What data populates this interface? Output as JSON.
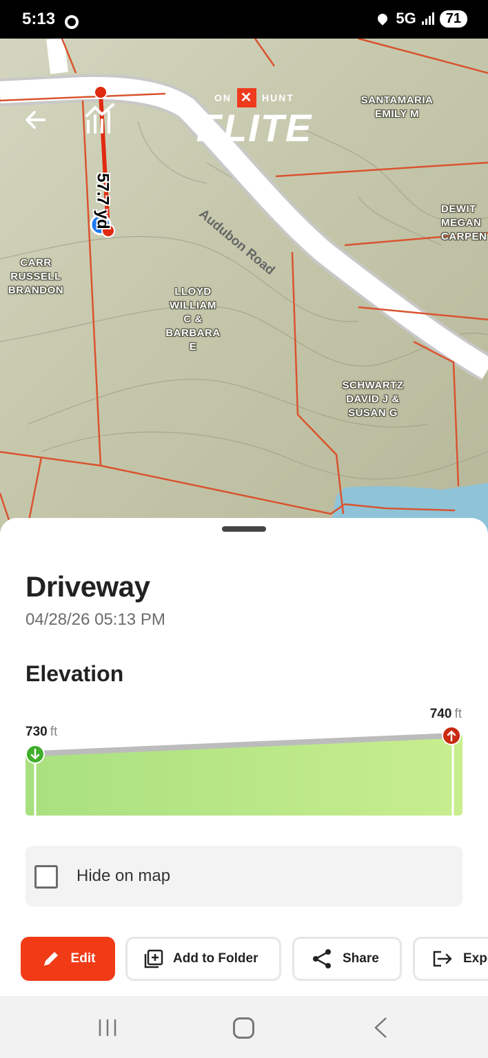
{
  "status_bar": {
    "time": "5:13",
    "network": "5G",
    "battery": "71"
  },
  "map": {
    "brand_top_left": "ON",
    "brand_x": "✕",
    "brand_top_right": "HUNT",
    "brand_main": "ELITE",
    "road_name": "Audubon Road",
    "measurement": "57.7 yd",
    "parcel_labels": {
      "santamaria": "SANTAMARIA\nEMILY M",
      "dewit": "DEWIT\nMEGAN\nCARPEN",
      "carr": "CARR\nRUSSELL\nBRANDON",
      "lloyd": "LLOYD\nWILLIAM\nC &\nBARBARA\nE",
      "schwartz": "SCHWARTZ\nDAVID J &\nSUSAN G"
    },
    "back_icon": "arrow-left-icon",
    "profile_icon": "elevation-profile-icon"
  },
  "sheet": {
    "title": "Driveway",
    "datetime": "04/28/26 05:13 PM",
    "section_title": "Elevation",
    "elevation": {
      "start_value": "730",
      "end_value": "740",
      "unit": "ft",
      "start": 730,
      "end": 740
    },
    "hide_on_map": {
      "label": "Hide on map",
      "checked": false
    },
    "actions": {
      "edit": "Edit",
      "add_to_folder": "Add to Folder",
      "share": "Share",
      "export": "Export"
    }
  },
  "colors": {
    "accent": "#f13b17",
    "parcel_line": "#d9532e",
    "elevation_fill": "#b8e98b",
    "start_marker": "#3fae2a",
    "end_marker": "#c92a12",
    "water": "#8ec3d8"
  }
}
